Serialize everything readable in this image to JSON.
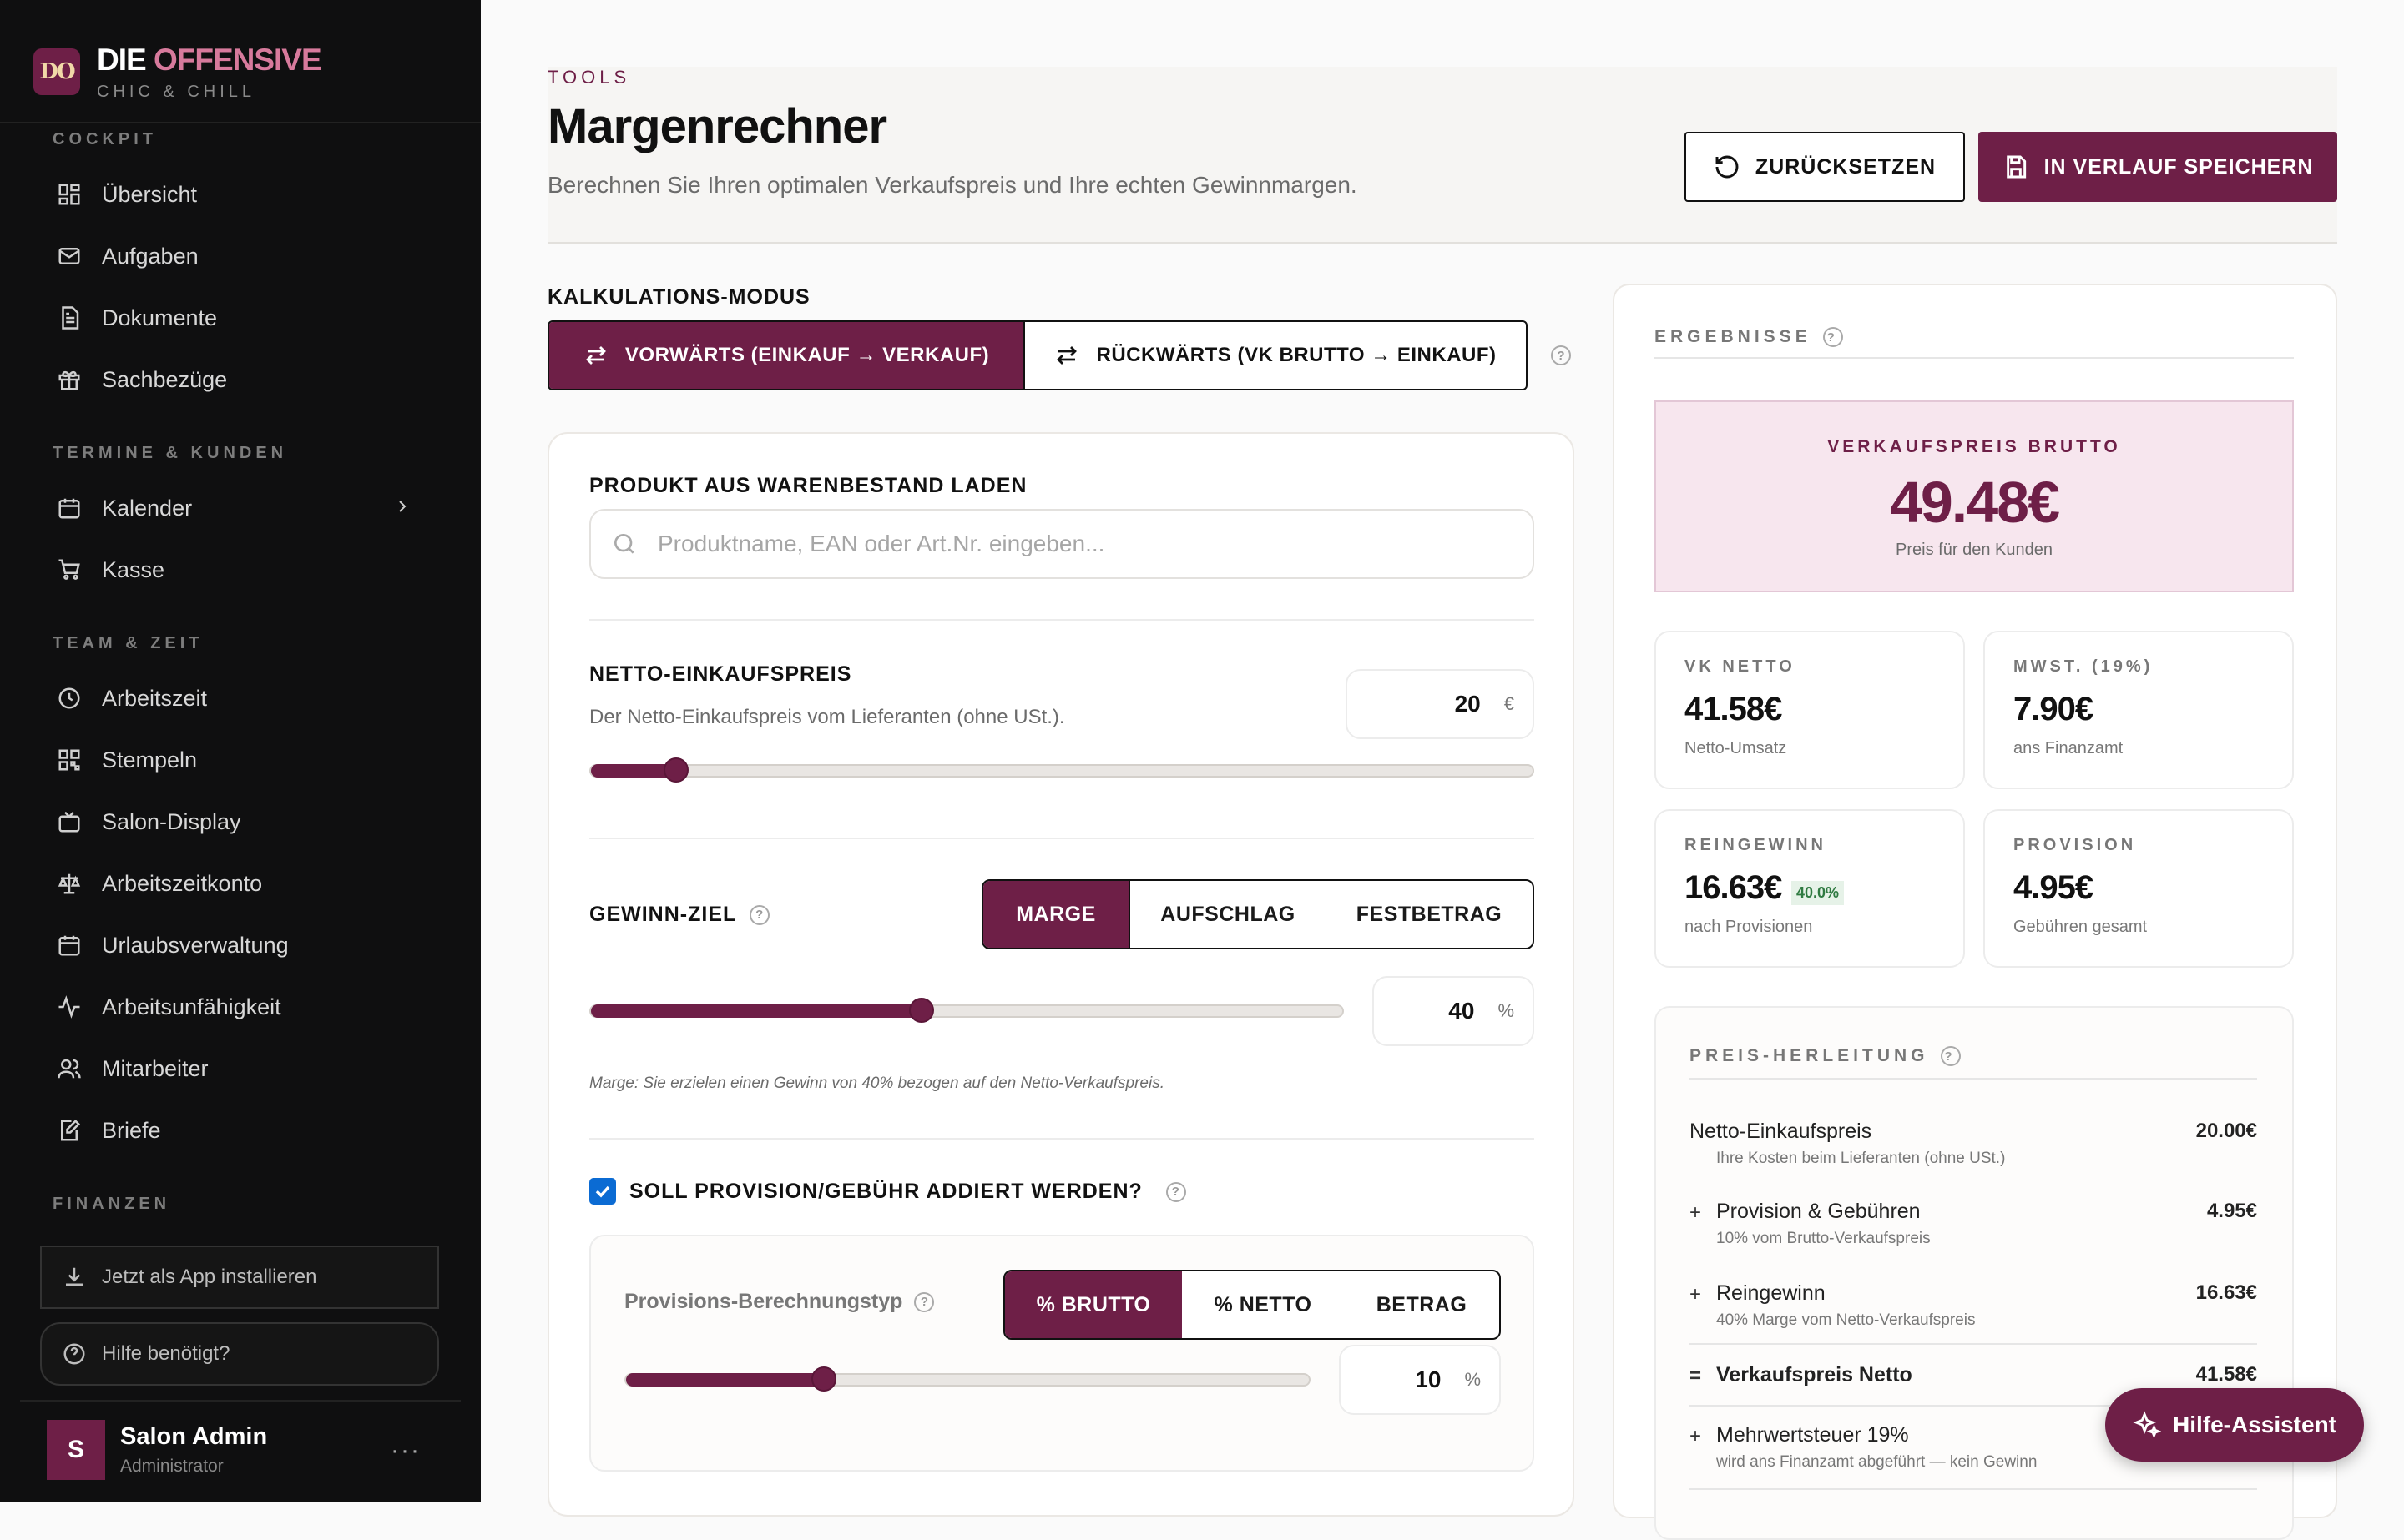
{
  "brand": {
    "logo": "DO",
    "name_part1": "DIE",
    "name_part2": "OFFENSIVE",
    "tagline": "CHIC & CHILL"
  },
  "sidebar": {
    "sections": [
      "COCKPIT",
      "TERMINE & KUNDEN",
      "TEAM & ZEIT",
      "FINANZEN"
    ],
    "items": [
      {
        "label": "Übersicht",
        "icon": "dashboard-icon"
      },
      {
        "label": "Aufgaben",
        "icon": "mail-icon"
      },
      {
        "label": "Dokumente",
        "icon": "document-icon"
      },
      {
        "label": "Sachbezüge",
        "icon": "gift-icon"
      },
      {
        "label": "Kalender",
        "icon": "calendar-icon"
      },
      {
        "label": "Kasse",
        "icon": "cart-icon"
      },
      {
        "label": "Arbeitszeit",
        "icon": "clock-icon"
      },
      {
        "label": "Stempeln",
        "icon": "qr-icon"
      },
      {
        "label": "Salon-Display",
        "icon": "tv-icon"
      },
      {
        "label": "Arbeitszeitkonto",
        "icon": "scale-icon"
      },
      {
        "label": "Urlaubsverwaltung",
        "icon": "calendar-icon"
      },
      {
        "label": "Arbeitsunfähigkeit",
        "icon": "activity-icon"
      },
      {
        "label": "Mitarbeiter",
        "icon": "users-icon"
      },
      {
        "label": "Briefe",
        "icon": "edit-icon"
      }
    ],
    "install_app": "Jetzt als App installieren",
    "help": "Hilfe benötigt?",
    "user": {
      "initial": "S",
      "name": "Salon Admin",
      "role": "Administrator",
      "more": "···"
    },
    "collapse": "‹"
  },
  "header": {
    "crumb": "TOOLS",
    "title": "Margenrechner",
    "subtitle": "Berechnen Sie Ihren optimalen Verkaufspreis und Ihre echten Gewinnmargen.",
    "reset_label": "ZURÜCKSETZEN",
    "save_label": "IN VERLAUF SPEICHERN"
  },
  "mode": {
    "label": "KALKULATIONS-MODUS",
    "forward": "VORWÄRTS (EINKAUF → VERKAUF)",
    "backward": "RÜCKWÄRTS (VK BRUTTO → EINKAUF)",
    "active": "forward"
  },
  "form": {
    "product_label": "PRODUKT AUS WARENBESTAND LADEN",
    "search_placeholder": "Produktname, EAN oder Art.Nr. eingeben...",
    "cost_label": "NETTO-EINKAUFSPREIS",
    "cost_desc": "Der Netto-Einkaufspreis vom Lieferanten (ohne USt.).",
    "cost_value": "20",
    "cost_unit": "€",
    "cost_slider_fraction": 0.09,
    "goal_label": "GEWINN-ZIEL",
    "goal_options": [
      "MARGE",
      "AUFSCHLAG",
      "FESTBETRAG"
    ],
    "goal_active": "MARGE",
    "goal_value": "40",
    "goal_unit": "%",
    "goal_slider_fraction": 0.44,
    "goal_note": "Marge: Sie erzielen einen Gewinn von 40% bezogen auf den Netto-Verkaufspreis.",
    "commission_check_label": "SOLL PROVISION/GEBÜHR ADDIERT WERDEN?",
    "commission_checked": true,
    "commission_type_label": "Provisions-Berechnungstyp",
    "commission_options": [
      "% BRUTTO",
      "% NETTO",
      "BETRAG"
    ],
    "commission_active": "% BRUTTO",
    "commission_value": "10",
    "commission_unit": "%",
    "commission_slider_fraction": 0.29
  },
  "results": {
    "title": "ERGEBNISSE",
    "hero_label": "VERKAUFSPREIS BRUTTO",
    "hero_value": "49.48€",
    "hero_sub": "Preis für den Kunden",
    "stats": [
      {
        "label": "VK NETTO",
        "value": "41.58€",
        "sub": "Netto-Umsatz"
      },
      {
        "label": "MWST. (19%)",
        "value": "7.90€",
        "sub": "ans Finanzamt"
      },
      {
        "label": "REINGEWINN",
        "value": "16.63€",
        "sub": "nach Provisionen",
        "badge": "40.0%"
      },
      {
        "label": "PROVISION",
        "value": "4.95€",
        "sub": "Gebühren gesamt"
      }
    ],
    "derivation_title": "PREIS-HERLEITUNG",
    "derivation": [
      {
        "op": "",
        "name": "Netto-Einkaufspreis",
        "desc": "Ihre Kosten beim Lieferanten (ohne USt.)",
        "amount": "20.00€"
      },
      {
        "op": "+",
        "name": "Provision & Gebühren",
        "desc": "10% vom Brutto-Verkaufspreis",
        "amount": "4.95€"
      },
      {
        "op": "+",
        "name": "Reingewinn",
        "desc": "40% Marge vom Netto-Verkaufspreis",
        "amount": "16.63€"
      },
      {
        "op": "=",
        "name": "Verkaufspreis Netto",
        "desc": "",
        "amount": "41.58€"
      },
      {
        "op": "+",
        "name": "Mehrwertsteuer 19%",
        "desc": "wird ans Finanzamt abgeführt — kein Gewinn",
        "amount": ""
      }
    ]
  },
  "assistant": {
    "label": "Hilfe-Assistent"
  },
  "colors": {
    "accent": "#6e1f47",
    "accent_light": "#f7e6ee",
    "sidebar_bg": "#0f0f10",
    "check_blue": "#0b6bd3"
  }
}
